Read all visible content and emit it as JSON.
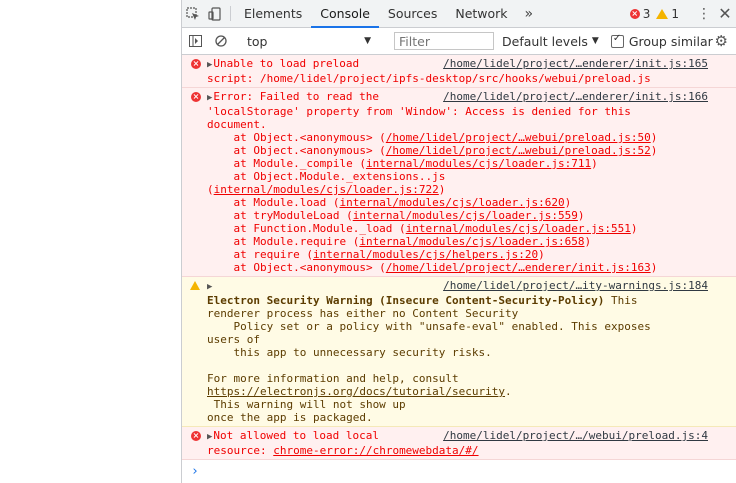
{
  "tabs": [
    "Elements",
    "Console",
    "Sources",
    "Network"
  ],
  "more_tabs": "»",
  "error_count": "3",
  "warning_count": "1",
  "toolbar": {
    "context": "top",
    "filter_placeholder": "Filter",
    "levels": "Default levels",
    "group_similar": "Group similar"
  },
  "messages": {
    "m1": {
      "src": "/home/lidel/project/…enderer/init.js:165",
      "l1": "Unable to load preload",
      "l2": "script: /home/lidel/project/ipfs-desktop/src/hooks/webui/preload.js"
    },
    "m2": {
      "src": "/home/lidel/project/…enderer/init.js:166",
      "l1": "Error: Failed to read the",
      "l2": "'localStorage' property from 'Window': Access is denied for this",
      "l3": "document.",
      "stack": [
        {
          "pre": "    at Object.<anonymous> (",
          "link": "/home/lidel/project/…webui/preload.js:50",
          "post": ")"
        },
        {
          "pre": "    at Object.<anonymous> (",
          "link": "/home/lidel/project/…webui/preload.js:52",
          "post": ")"
        },
        {
          "pre": "    at Module._compile (",
          "link": "internal/modules/cjs/loader.js:711",
          "post": ")"
        },
        {
          "pre": "    at Object.Module._extensions..js",
          "link": "",
          "post": ""
        },
        {
          "pre": "(",
          "link": "internal/modules/cjs/loader.js:722",
          "post": ")"
        },
        {
          "pre": "    at Module.load (",
          "link": "internal/modules/cjs/loader.js:620",
          "post": ")"
        },
        {
          "pre": "    at tryModuleLoad (",
          "link": "internal/modules/cjs/loader.js:559",
          "post": ")"
        },
        {
          "pre": "    at Function.Module._load (",
          "link": "internal/modules/cjs/loader.js:551",
          "post": ")"
        },
        {
          "pre": "    at Module.require (",
          "link": "internal/modules/cjs/loader.js:658",
          "post": ")"
        },
        {
          "pre": "    at require (",
          "link": "internal/modules/cjs/helpers.js:20",
          "post": ")"
        },
        {
          "pre": "    at Object.<anonymous> (",
          "link": "/home/lidel/project/…enderer/init.js:163",
          "post": ")"
        }
      ]
    },
    "m3": {
      "src": "/home/lidel/project/…ity-warnings.js:184",
      "title": "Electron Security Warning (Insecure Content-Security-Policy)",
      "t1": " This",
      "l2": "renderer process has either no Content Security",
      "l3": "    Policy set or a policy with \"unsafe-eval\" enabled. This exposes",
      "l4": "users of",
      "l5": "    this app to unnecessary security risks.",
      "l6": "For more information and help, consult",
      "link": "https://electronjs.org/docs/tutorial/security",
      "l7post": ".",
      "l8": " This warning will not show up",
      "l9": "once the app is packaged."
    },
    "m4": {
      "src": "/home/lidel/project/…/webui/preload.js:4",
      "l1": "Not allowed to load local",
      "l2pre": "resource: ",
      "l2link": "chrome-error://chromewebdata/#/"
    }
  },
  "prompt": "›"
}
